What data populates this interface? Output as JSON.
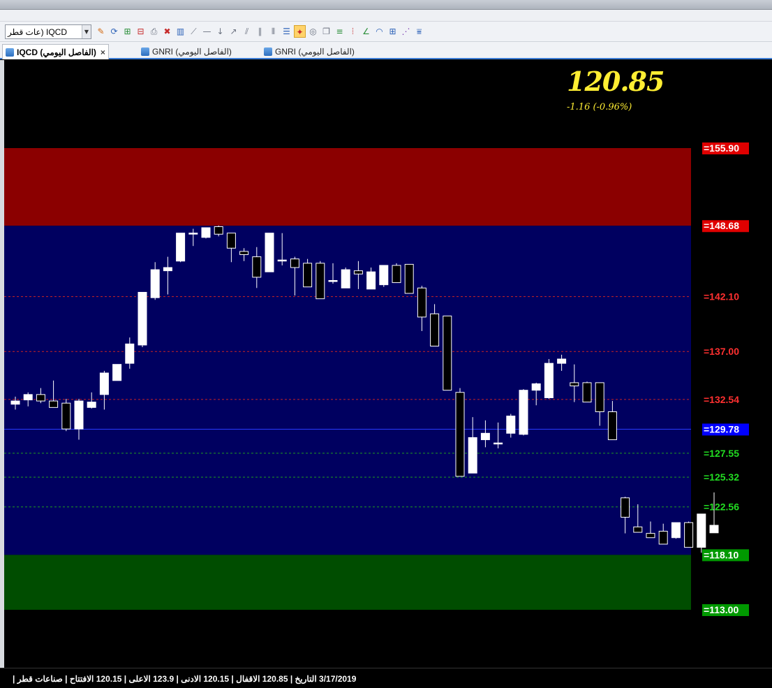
{
  "window": {
    "title": ""
  },
  "toolbar": {
    "symbol_value": "عات قطر) IQCD",
    "tools": [
      {
        "icon": "pencil-icon",
        "glyph": "✎",
        "color": "c-orange"
      },
      {
        "icon": "refresh-icon",
        "glyph": "⟳",
        "color": "c-blue"
      },
      {
        "icon": "add-window-icon",
        "glyph": "⊞",
        "color": "c-green"
      },
      {
        "icon": "remove-window-icon",
        "glyph": "⊟",
        "color": "c-red"
      },
      {
        "icon": "print-icon",
        "glyph": "⎙",
        "color": "c-gray"
      },
      {
        "icon": "close-red-icon",
        "glyph": "✖",
        "color": "c-red"
      },
      {
        "icon": "bar-chart-icon",
        "glyph": "▥",
        "color": "c-blue"
      },
      {
        "icon": "trend-line-icon",
        "glyph": "⟋",
        "color": "c-gray"
      },
      {
        "icon": "horizontal-line-icon",
        "glyph": "—",
        "color": "c-gray"
      },
      {
        "icon": "arrow-down-icon",
        "glyph": "↓",
        "color": "c-gray"
      },
      {
        "icon": "arrow-up-right-icon",
        "glyph": "↗",
        "color": "c-gray"
      },
      {
        "icon": "parallel-lines-icon",
        "glyph": "⫽",
        "color": "c-gray"
      },
      {
        "icon": "channel-icon",
        "glyph": "∥",
        "color": "c-gray"
      },
      {
        "icon": "vertical-lines-icon",
        "glyph": "⦀",
        "color": "c-gray"
      },
      {
        "icon": "horizontal-levels-icon",
        "glyph": "☰",
        "color": "c-blue"
      },
      {
        "icon": "support-resistance-icon",
        "glyph": "✦",
        "color": "c-red",
        "active": true
      },
      {
        "icon": "ellipse-icon",
        "glyph": "◎",
        "color": "c-gray"
      },
      {
        "icon": "copy-icon",
        "glyph": "❐",
        "color": "c-gray"
      },
      {
        "icon": "levels-icon",
        "glyph": "≡",
        "color": "c-green"
      },
      {
        "icon": "vertical-bars-icon",
        "glyph": "⦙",
        "color": "c-red"
      },
      {
        "icon": "angle-icon",
        "glyph": "∠",
        "color": "c-green"
      },
      {
        "icon": "fibonacci-arc-icon",
        "glyph": "◠",
        "color": "c-blue"
      },
      {
        "icon": "fibonacci-grid-icon",
        "glyph": "⊞",
        "color": "c-blue"
      },
      {
        "icon": "fan-icon",
        "glyph": "⋰",
        "color": "c-purple"
      },
      {
        "icon": "fib-retracement-icon",
        "glyph": "⩸",
        "color": "c-blue"
      }
    ]
  },
  "tabs": [
    {
      "label": "IQCD (الفاصل اليومي)",
      "active": true
    },
    {
      "label": "GNRI (الفاصل اليومي)",
      "active": false
    },
    {
      "label": "GNRI (الفاصل اليومي)",
      "active": false
    }
  ],
  "quote": {
    "last_price": "120.85",
    "change": "-1.16  (-0.96%)"
  },
  "chart_data": {
    "type": "candlestick",
    "title": "",
    "ylim": [
      109.5,
      167.5
    ],
    "zones": [
      {
        "from": 148.68,
        "to": 155.9,
        "color": "#8b0000"
      },
      {
        "from": 118.1,
        "to": 148.68,
        "color": "#000060"
      },
      {
        "from": 113.0,
        "to": 118.1,
        "color": "#004d00"
      }
    ],
    "levels": [
      {
        "value": 155.9,
        "label": "=155.90",
        "label_bg": "#e00000",
        "label_fg": "#ffffff",
        "line": false
      },
      {
        "value": 148.68,
        "label": "=148.68",
        "label_bg": "#e00000",
        "label_fg": "#ffffff",
        "line": false
      },
      {
        "value": 142.1,
        "label": "=142.10",
        "label_bg": "",
        "label_fg": "#ff3030",
        "line": "#cc2222"
      },
      {
        "value": 137.0,
        "label": "=137.00",
        "label_bg": "",
        "label_fg": "#ff3030",
        "line": "#cc2222"
      },
      {
        "value": 132.54,
        "label": "=132.54",
        "label_bg": "",
        "label_fg": "#ff3030",
        "line": "#cc2222"
      },
      {
        "value": 129.78,
        "label": "=129.78",
        "label_bg": "#0000ff",
        "label_fg": "#ffffff",
        "line": "#2a3bff",
        "solid": true
      },
      {
        "value": 127.55,
        "label": "=127.55",
        "label_bg": "",
        "label_fg": "#22dd22",
        "line": "#1f9c1f"
      },
      {
        "value": 125.32,
        "label": "=125.32",
        "label_bg": "",
        "label_fg": "#22dd22",
        "line": "#1f9c1f"
      },
      {
        "value": 122.56,
        "label": "=122.56",
        "label_bg": "",
        "label_fg": "#22dd22",
        "line": "#1f9c1f"
      },
      {
        "value": 118.1,
        "label": "=118.10",
        "label_bg": "#009900",
        "label_fg": "#ffffff",
        "line": false
      },
      {
        "value": 113.0,
        "label": "=113.00",
        "label_bg": "#009900",
        "label_fg": "#ffffff",
        "line": false
      }
    ],
    "candles": [
      {
        "o": 132.1,
        "h": 132.8,
        "l": 131.6,
        "c": 132.4
      },
      {
        "o": 132.5,
        "h": 133.2,
        "l": 131.9,
        "c": 133.0
      },
      {
        "o": 133.0,
        "h": 133.6,
        "l": 132.2,
        "c": 132.4
      },
      {
        "o": 132.4,
        "h": 134.3,
        "l": 131.8,
        "c": 131.8
      },
      {
        "o": 132.2,
        "h": 132.6,
        "l": 129.6,
        "c": 129.8
      },
      {
        "o": 129.8,
        "h": 132.6,
        "l": 128.8,
        "c": 132.4
      },
      {
        "o": 131.8,
        "h": 133.2,
        "l": 131.7,
        "c": 132.3
      },
      {
        "o": 133.0,
        "h": 135.2,
        "l": 131.6,
        "c": 135.0
      },
      {
        "o": 134.3,
        "h": 135.8,
        "l": 134.3,
        "c": 135.8
      },
      {
        "o": 135.9,
        "h": 138.3,
        "l": 135.4,
        "c": 137.7
      },
      {
        "o": 137.6,
        "h": 142.5,
        "l": 137.4,
        "c": 142.5
      },
      {
        "o": 142.0,
        "h": 145.3,
        "l": 141.8,
        "c": 144.6
      },
      {
        "o": 144.5,
        "h": 145.8,
        "l": 142.3,
        "c": 144.8
      },
      {
        "o": 145.4,
        "h": 148.0,
        "l": 145.3,
        "c": 148.0
      },
      {
        "o": 148.0,
        "h": 148.4,
        "l": 146.8,
        "c": 148.0
      },
      {
        "o": 147.6,
        "h": 148.5,
        "l": 147.5,
        "c": 148.5
      },
      {
        "o": 148.6,
        "h": 148.7,
        "l": 147.7,
        "c": 147.9
      },
      {
        "o": 148.0,
        "h": 147.8,
        "l": 145.3,
        "c": 146.6
      },
      {
        "o": 146.3,
        "h": 146.6,
        "l": 145.4,
        "c": 146.0
      },
      {
        "o": 145.8,
        "h": 146.7,
        "l": 142.9,
        "c": 143.9
      },
      {
        "o": 144.4,
        "h": 148.0,
        "l": 144.4,
        "c": 148.0
      },
      {
        "o": 145.5,
        "h": 148.0,
        "l": 145.0,
        "c": 145.5
      },
      {
        "o": 145.6,
        "h": 145.8,
        "l": 142.2,
        "c": 144.8
      },
      {
        "o": 145.2,
        "h": 145.6,
        "l": 143.0,
        "c": 143.0
      },
      {
        "o": 145.2,
        "h": 145.4,
        "l": 141.9,
        "c": 141.9
      },
      {
        "o": 143.5,
        "h": 145.2,
        "l": 143.3,
        "c": 143.6
      },
      {
        "o": 142.9,
        "h": 144.8,
        "l": 142.9,
        "c": 144.6
      },
      {
        "o": 144.5,
        "h": 145.4,
        "l": 142.8,
        "c": 144.2
      },
      {
        "o": 142.8,
        "h": 144.8,
        "l": 142.8,
        "c": 144.4
      },
      {
        "o": 143.2,
        "h": 145.0,
        "l": 143.0,
        "c": 145.0
      },
      {
        "o": 145.0,
        "h": 145.2,
        "l": 143.4,
        "c": 143.4
      },
      {
        "o": 145.1,
        "h": 145.1,
        "l": 142.4,
        "c": 142.4
      },
      {
        "o": 142.9,
        "h": 143.1,
        "l": 138.9,
        "c": 140.2
      },
      {
        "o": 140.5,
        "h": 141.4,
        "l": 137.5,
        "c": 137.5
      },
      {
        "o": 140.3,
        "h": 140.3,
        "l": 133.4,
        "c": 133.4
      },
      {
        "o": 133.2,
        "h": 133.6,
        "l": 125.4,
        "c": 125.4
      },
      {
        "o": 125.7,
        "h": 130.9,
        "l": 125.7,
        "c": 129.0
      },
      {
        "o": 128.8,
        "h": 130.6,
        "l": 128.1,
        "c": 129.4
      },
      {
        "o": 128.5,
        "h": 130.4,
        "l": 128.0,
        "c": 128.5
      },
      {
        "o": 129.4,
        "h": 131.2,
        "l": 129.0,
        "c": 131.0
      },
      {
        "o": 129.3,
        "h": 133.5,
        "l": 129.2,
        "c": 133.4
      },
      {
        "o": 133.4,
        "h": 134.1,
        "l": 132.0,
        "c": 134.0
      },
      {
        "o": 132.7,
        "h": 136.3,
        "l": 132.6,
        "c": 135.9
      },
      {
        "o": 135.9,
        "h": 136.7,
        "l": 135.2,
        "c": 136.3
      },
      {
        "o": 134.1,
        "h": 135.8,
        "l": 132.3,
        "c": 133.8
      },
      {
        "o": 134.1,
        "h": 134.2,
        "l": 132.3,
        "c": 132.3
      },
      {
        "o": 134.1,
        "h": 134.1,
        "l": 130.1,
        "c": 131.4
      },
      {
        "o": 131.4,
        "h": 132.4,
        "l": 128.8,
        "c": 128.8
      },
      {
        "o": 123.4,
        "h": 123.5,
        "l": 120.1,
        "c": 121.6
      },
      {
        "o": 120.7,
        "h": 122.8,
        "l": 120.2,
        "c": 120.2
      },
      {
        "o": 120.1,
        "h": 121.2,
        "l": 119.7,
        "c": 119.7
      },
      {
        "o": 120.3,
        "h": 121.0,
        "l": 119.1,
        "c": 119.1
      },
      {
        "o": 119.7,
        "h": 120.9,
        "l": 119.6,
        "c": 121.1
      },
      {
        "o": 121.1,
        "h": 121.2,
        "l": 118.8,
        "c": 118.8
      },
      {
        "o": 118.8,
        "h": 121.9,
        "l": 118.3,
        "c": 121.9
      },
      {
        "o": 120.15,
        "h": 123.9,
        "l": 120.15,
        "c": 120.85
      }
    ]
  },
  "status": {
    "text": "3/17/2019 التاريخ   |   120.85 الاقفال   |   120.15 الادنى   |   123.9 الاعلى   |   120.15 الافتتاح   |   صناعات قطر   |"
  }
}
